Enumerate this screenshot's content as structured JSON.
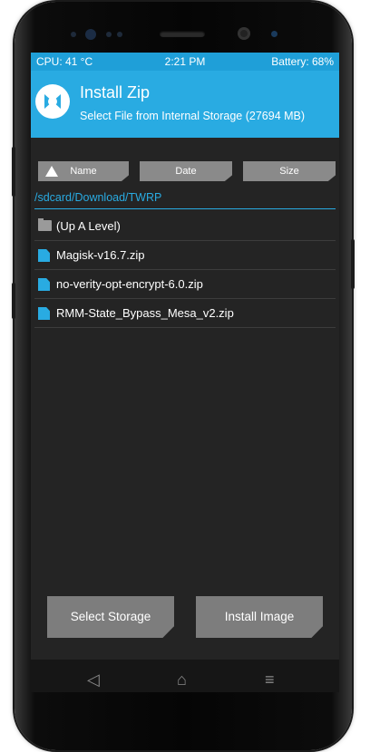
{
  "status_bar": {
    "cpu": "CPU: 41 °C",
    "time": "2:21 PM",
    "battery": "Battery: 68%"
  },
  "header": {
    "title": "Install Zip",
    "subtitle": "Select File from Internal Storage (27694 MB)"
  },
  "sort": {
    "name_label": "Name",
    "date_label": "Date",
    "size_label": "Size"
  },
  "path": "/sdcard/Download/TWRP",
  "files": [
    {
      "label": "(Up A Level)",
      "icon": "folder-icon"
    },
    {
      "label": "Magisk-v16.7.zip",
      "icon": "file-icon"
    },
    {
      "label": "no-verity-opt-encrypt-6.0.zip",
      "icon": "file-icon"
    },
    {
      "label": "RMM-State_Bypass_Mesa_v2.zip",
      "icon": "file-icon"
    }
  ],
  "buttons": {
    "select_storage": "Select Storage",
    "install_image": "Install Image"
  },
  "nav": {
    "back": "◁",
    "home": "⌂",
    "menu": "≡"
  },
  "colors": {
    "accent": "#29abe2",
    "status_bar": "#1f9fd8",
    "background": "#242424",
    "button": "#7d7d7d"
  }
}
